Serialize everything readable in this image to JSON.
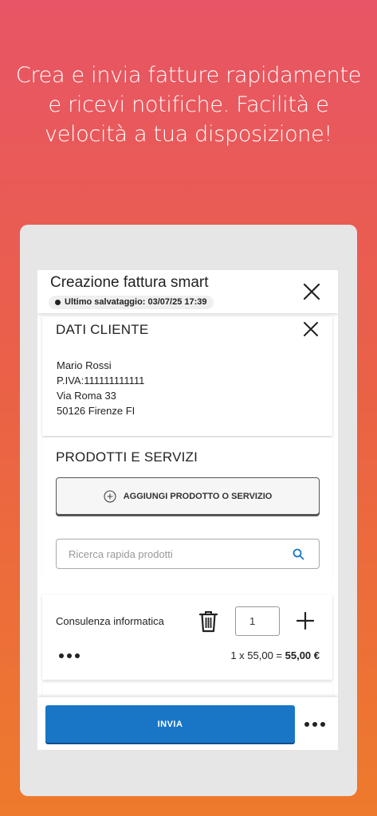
{
  "headline": {
    "line1": "Crea e invia fatture rapidamente",
    "line2": "e ricevi notifiche. Facilità e",
    "line3": "velocità a tua disposizione!"
  },
  "topbar": {
    "title": "Creazione fattura smart",
    "save_status": "Ultimo salvataggio: 03/07/25 17:39"
  },
  "client": {
    "section_title": "DATI CLIENTE",
    "name": "Mario Rossi",
    "vat": "P.IVA:111111111111",
    "address": "Via Roma 33",
    "city": "50126 Firenze FI"
  },
  "products": {
    "section_title": "PRODOTTI E SERVIZI",
    "add_button_label": "AGGIUNGI PRODOTTO O SERVIZIO",
    "search_placeholder": "Ricerca rapida prodotti",
    "items": [
      {
        "name": "Consulenza informatica",
        "quantity": "1",
        "price_formula": "1 x 55,00 = ",
        "total": "55,00 €"
      }
    ]
  },
  "footer": {
    "send_label": "INVIA"
  },
  "icons": [
    "close-icon",
    "plus-circle-icon",
    "search-icon",
    "trash-icon",
    "plus-icon",
    "more-icon"
  ],
  "colors": {
    "gradient_top": "#e85566",
    "gradient_bottom": "#ee7a2c",
    "primary_button": "#1976c7",
    "search_icon": "#1976c7"
  }
}
